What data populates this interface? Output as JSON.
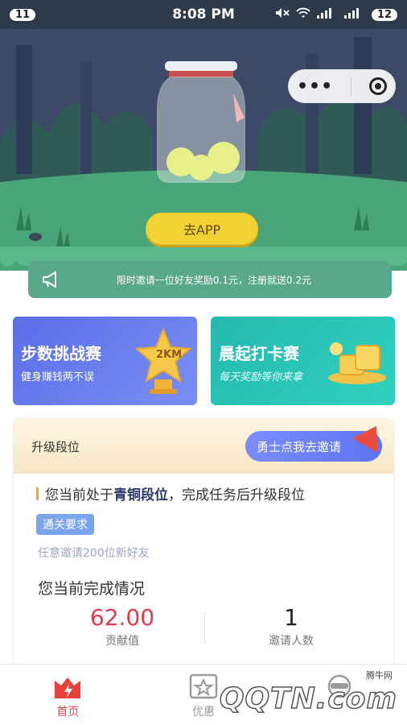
{
  "status_bar": {
    "notif_count": "11",
    "time": "8:08 PM",
    "battery": "12"
  },
  "hero": {
    "go_app_label": "去APP"
  },
  "notice": {
    "text": "限时邀请一位好友奖励0.1元，注册就送0.2元"
  },
  "cards": [
    {
      "title": "步数挑战赛",
      "subtitle": "健身赚钱两不误",
      "badge": "2KM"
    },
    {
      "title": "晨起打卡赛",
      "subtitle": "每天奖励等你来拿"
    }
  ],
  "rank": {
    "header": "升级段位",
    "invite_label": "勇士点我去邀请",
    "current_prefix": "您当前处于",
    "current_level": "青铜段位",
    "current_suffix": "，完成任务后升级段位",
    "requirement_tag": "通关要求",
    "requirement_text": "任意邀请200位新好友",
    "status_title": "您当前完成情况",
    "contribution_value": "62.00",
    "contribution_label": "贡献值",
    "invites_value": "1",
    "invites_label": "邀请人数"
  },
  "tabs": [
    {
      "label": "首页",
      "active": true
    },
    {
      "label": "优惠",
      "active": false
    },
    {
      "label": "",
      "active": false
    }
  ],
  "watermark": {
    "brand": "QQTN.com",
    "cn": "腾牛网"
  },
  "colors": {
    "accent": "#e8413c",
    "hero_bg": "#3c4a68",
    "notice_bg": "#5aa88a",
    "button_yellow": "#f2d233"
  }
}
